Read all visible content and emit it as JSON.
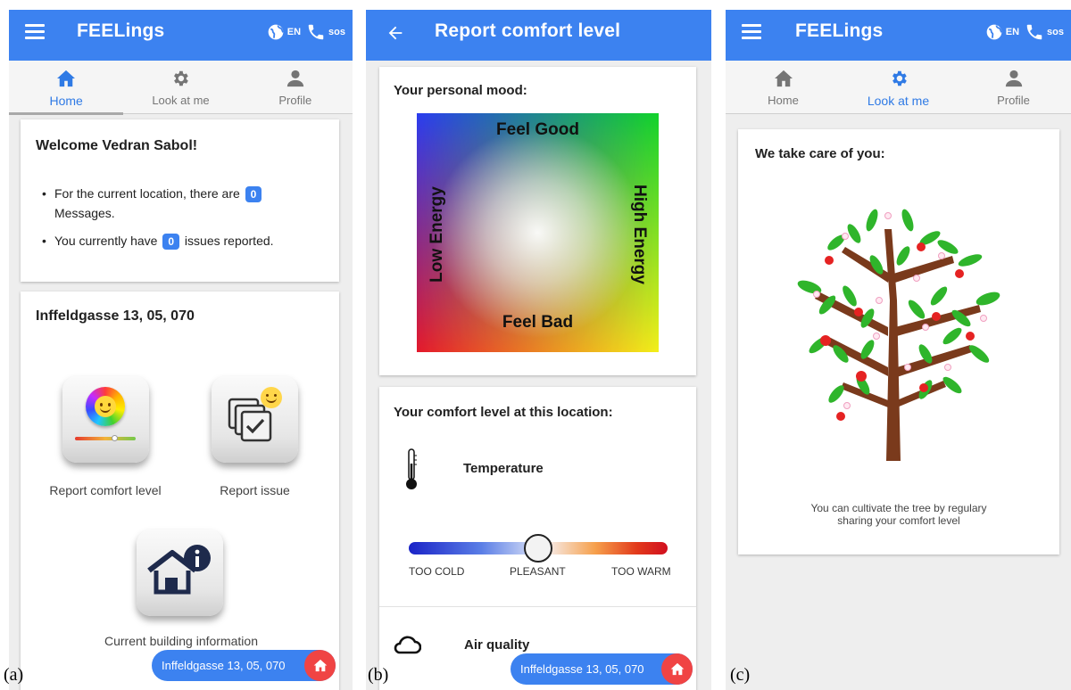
{
  "figure_labels": [
    "(a)",
    "(b)",
    "(c)"
  ],
  "colors": {
    "primary": "#3c82f0",
    "accent_red": "#f04444",
    "tab_active": "#2f7ae5"
  },
  "appbar": {
    "title": "FEELings",
    "language": "EN",
    "sos": "SOS",
    "icons": [
      "menu-icon",
      "globe-icon",
      "phone-icon",
      "back-arrow-icon"
    ]
  },
  "tabs": [
    {
      "label": "Home",
      "icon": "home-icon"
    },
    {
      "label": "Look at me",
      "icon": "gear-icon"
    },
    {
      "label": "Profile",
      "icon": "person-icon"
    }
  ],
  "screen_a": {
    "welcome_title": "Welcome Vedran Sabol!",
    "bullet1_pre": "For the current location, there are",
    "bullet1_count": "0",
    "bullet1_post": "Messages.",
    "bullet2_pre": "You currently have",
    "bullet2_count": "0",
    "bullet2_post": "issues reported.",
    "location_title": "Inffeldgasse 13, 05, 070",
    "actions": {
      "report_comfort": "Report comfort level",
      "report_issue": "Report issue",
      "building_info": "Current building information"
    },
    "location_pill": "Inffeldgasse 13, 05, 070"
  },
  "screen_b": {
    "title": "Report comfort level",
    "mood_title": "Your personal mood:",
    "mood_labels": {
      "top": "Feel Good",
      "bottom": "Feel Bad",
      "left": "Low Energy",
      "right": "High Energy"
    },
    "comfort_title": "Your comfort level at this location:",
    "temperature": {
      "label": "Temperature",
      "value_fraction": 0.5,
      "scale": [
        "TOO COLD",
        "PLEASANT",
        "TOO WARM"
      ]
    },
    "air_quality_label": "Air quality",
    "location_pill": "Inffeldgasse 13, 05, 070"
  },
  "screen_c": {
    "card_title": "We take care of you:",
    "caption_line1": "You can cultivate the tree by regulary",
    "caption_line2": "sharing your comfort level"
  }
}
